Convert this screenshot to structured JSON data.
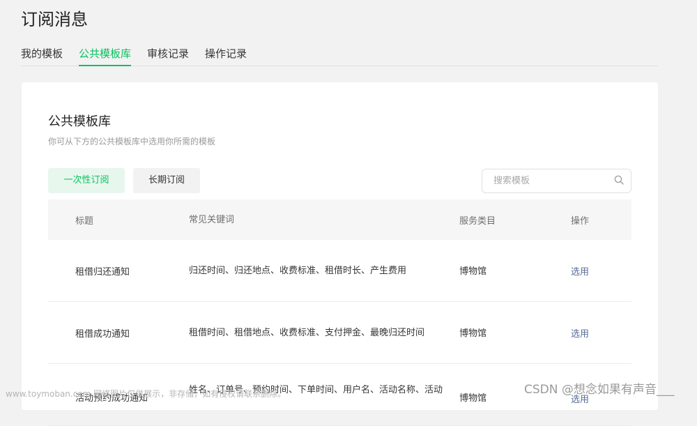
{
  "page": {
    "title": "订阅消息"
  },
  "tabs": [
    {
      "label": "我的模板",
      "active": false
    },
    {
      "label": "公共模板库",
      "active": true
    },
    {
      "label": "审核记录",
      "active": false
    },
    {
      "label": "操作记录",
      "active": false
    }
  ],
  "card": {
    "title": "公共模板库",
    "description": "你可从下方的公共模板库中选用你所需的模板",
    "sub_tabs": [
      {
        "label": "一次性订阅",
        "active": true
      },
      {
        "label": "长期订阅",
        "active": false
      }
    ],
    "search": {
      "placeholder": "搜索模板"
    }
  },
  "table": {
    "headers": [
      "标题",
      "常见关键词",
      "服务类目",
      "操作"
    ],
    "rows": [
      {
        "title": "租借归还通知",
        "keywords": "归还时间、归还地点、收费标准、租借时长、产生费用",
        "category": "博物馆",
        "action": "选用"
      },
      {
        "title": "租借成功通知",
        "keywords": "租借时间、租借地点、收费标准、支付押金、最晚归还时间",
        "category": "博物馆",
        "action": "选用"
      },
      {
        "title": "活动预约成功通知",
        "keywords": "姓名、订单号、预约时间、下单时间、用户名、活动名称、活动",
        "category": "博物馆",
        "action": "选用"
      }
    ]
  },
  "watermarks": {
    "left": "www.toymoban.com 网络图片仅供展示，非存储，如有侵权请联系删除。",
    "right": "CSDN @想念如果有声音___"
  },
  "colors": {
    "accent": "#07c160",
    "link": "#576b95",
    "background": "#f2f2f2"
  }
}
